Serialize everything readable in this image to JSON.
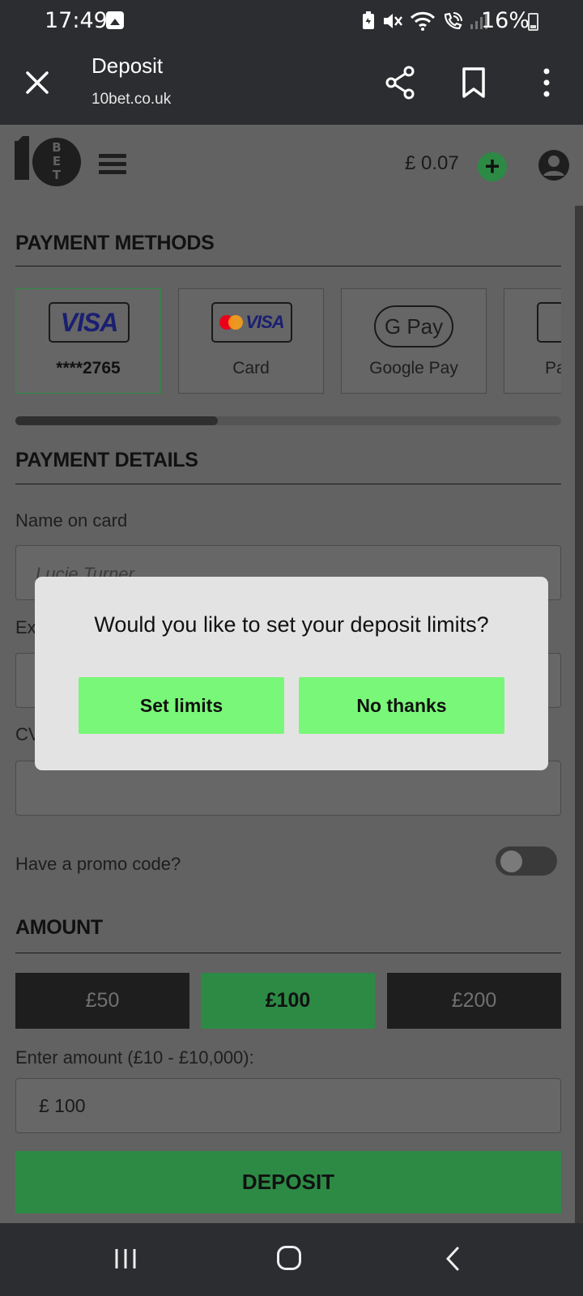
{
  "status_bar": {
    "time": "17:49",
    "battery": "16%"
  },
  "browser": {
    "title": "Deposit",
    "url": "10bet.co.uk"
  },
  "header": {
    "balance": "£ 0.07",
    "add_label": "+"
  },
  "payment_methods": {
    "title": "PAYMENT METHODS",
    "items": [
      {
        "label": "****2765",
        "brand": "VISA"
      },
      {
        "label": "Card",
        "brand": "VISA"
      },
      {
        "label": "Google Pay",
        "brand": "G Pay"
      },
      {
        "label": "Pa"
      }
    ]
  },
  "payment_details": {
    "title": "PAYMENT DETAILS",
    "name_label": "Name on card",
    "name_placeholder": "Lucie Turner",
    "expiry_label_partial": "Ex",
    "cvv_label_partial": "CV",
    "promo_label": "Have a promo code?"
  },
  "amount": {
    "title": "AMOUNT",
    "options": [
      "£50",
      "£100",
      "£200"
    ],
    "selected_index": 1,
    "enter_label": "Enter amount (£10 - £10,000):",
    "value": "£ 100",
    "deposit_label": "DEPOSIT"
  },
  "modal": {
    "question": "Would you like to set your deposit limits?",
    "set_limits": "Set limits",
    "no_thanks": "No thanks"
  },
  "colors": {
    "accent_green": "#2d8a45",
    "modal_button": "#79f778",
    "visa_blue": "#1a1f71"
  }
}
